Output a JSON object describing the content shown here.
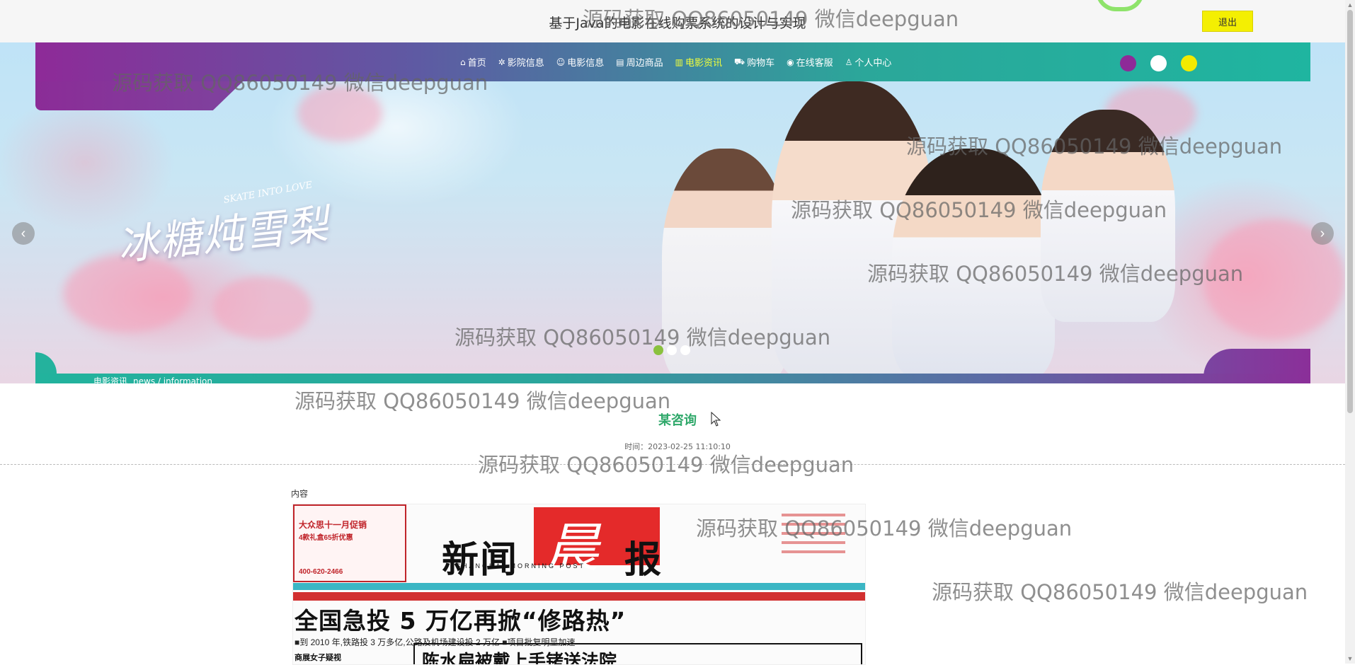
{
  "header": {
    "site_title": "基于Java的电影在线购票系统的设计与实现",
    "logout_label": "退出"
  },
  "nav": {
    "items": [
      {
        "icon": "home-icon",
        "glyph": "⌂",
        "label": "首页",
        "active": false
      },
      {
        "icon": "cinema-icon",
        "glyph": "✲",
        "label": "影院信息",
        "active": false
      },
      {
        "icon": "movie-icon",
        "glyph": "☺",
        "label": "电影信息",
        "active": false
      },
      {
        "icon": "goods-icon",
        "glyph": "▤",
        "label": "周边商品",
        "active": false
      },
      {
        "icon": "news-icon",
        "glyph": "▥",
        "label": "电影资讯",
        "active": true
      },
      {
        "icon": "cart-icon",
        "glyph": "⛟",
        "label": "购物车",
        "active": false
      },
      {
        "icon": "service-icon",
        "glyph": "◉",
        "label": "在线客服",
        "active": false
      },
      {
        "icon": "user-icon",
        "glyph": "♙",
        "label": "个人中心",
        "active": false
      }
    ],
    "theme_swatches": [
      "#8e2a98",
      "#ffffff",
      "#f3ea00"
    ]
  },
  "banner": {
    "poster_title": "冰糖炖雪梨",
    "poster_subtitle": "SKATE INTO LOVE",
    "prev_glyph": "‹",
    "next_glyph": "›",
    "slide_count": 3,
    "active_slide": 1
  },
  "breadcrumb": {
    "section": "电影资讯",
    "path": "news / information"
  },
  "article": {
    "title": "某咨询",
    "time": "时间：2023-02-25 11:10:10",
    "content_label": "内容"
  },
  "newspaper": {
    "masthead": "新闻",
    "masthead_highlight": "晨",
    "masthead_tail": "报",
    "masthead_sub": "SHANGHAI MORNING POST",
    "ad_line1": "大众思十一月促销",
    "ad_line2": "4款礼盒65折优惠",
    "ad_phone": "400-620-2466",
    "headline": "全国急投 5 万亿再掀“修路热”",
    "deck": "■到 2010 年,铁路投 3 万多亿,公路及机场建设投 2 万亿     ■项目批复明显加速",
    "box_headline": "陈水扁被戴上手铐送法院",
    "small_text": "商展女子疑视"
  },
  "watermarks": [
    "源码获取 QQ86050149 微信deepguan",
    "源码获取 QQ86050149 微信deepguan",
    "源码获取 QQ86050149 微信deepguan",
    "源码获取 QQ86050149 微信deepguan",
    "源码获取 QQ86050149 微信deepguan",
    "源码获取 QQ86050149 微信deepguan",
    "源码获取 QQ86050149 微信deepguan",
    "源码获取 QQ86050149 微信deepguan",
    "源码获取 QQ86050149 微信deepguan",
    "源码获取 QQ86050149 微信deepguan"
  ]
}
